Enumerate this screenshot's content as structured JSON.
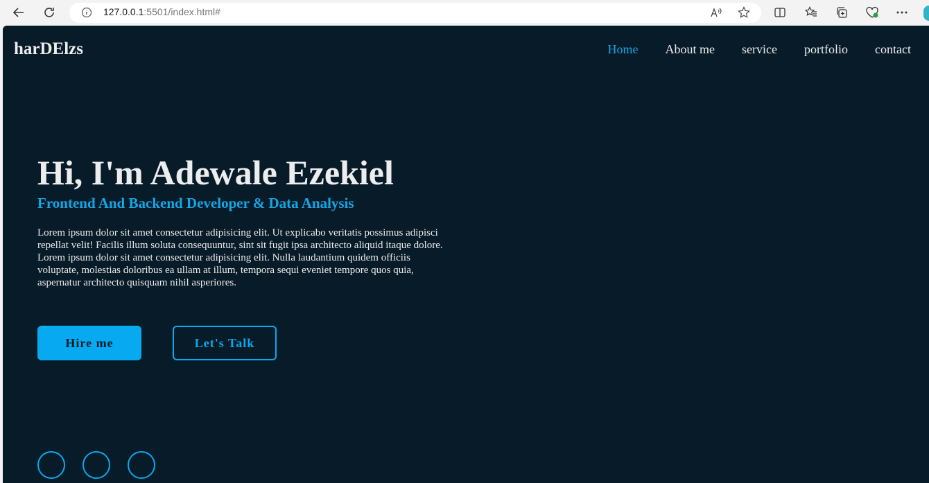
{
  "browser": {
    "url_host": "127.0.0.1",
    "url_rest": ":5501/index.html#"
  },
  "site": {
    "logo": "harDElzs",
    "nav": [
      {
        "label": "Home",
        "active": true
      },
      {
        "label": "About me"
      },
      {
        "label": "service"
      },
      {
        "label": "portfolio"
      },
      {
        "label": "contact"
      }
    ]
  },
  "hero": {
    "heading": "Hi, I'm Adewale Ezekiel",
    "subheading": "Frontend And Backend Developer & Data Analysis",
    "body": "Lorem ipsum dolor sit amet consectetur adipisicing elit. Ut explicabo veritatis possimus adipisci repellat velit! Facilis illum soluta consequuntur, sint sit fugit ipsa architecto aliquid itaque dolore. Lorem ipsum dolor sit amet consectetur adipisicing elit. Nulla laudantium quidem officiis voluptate, molestias doloribus ea ullam at illum, tempora sequi eveniet tempore quos quia, aspernatur architecto quisquam nihil asperiores.",
    "primary_button": "Hire me",
    "secondary_button": "Let's Talk"
  },
  "colors": {
    "background": "#081b29",
    "accent": "#07aaf0",
    "text": "#ededed"
  }
}
